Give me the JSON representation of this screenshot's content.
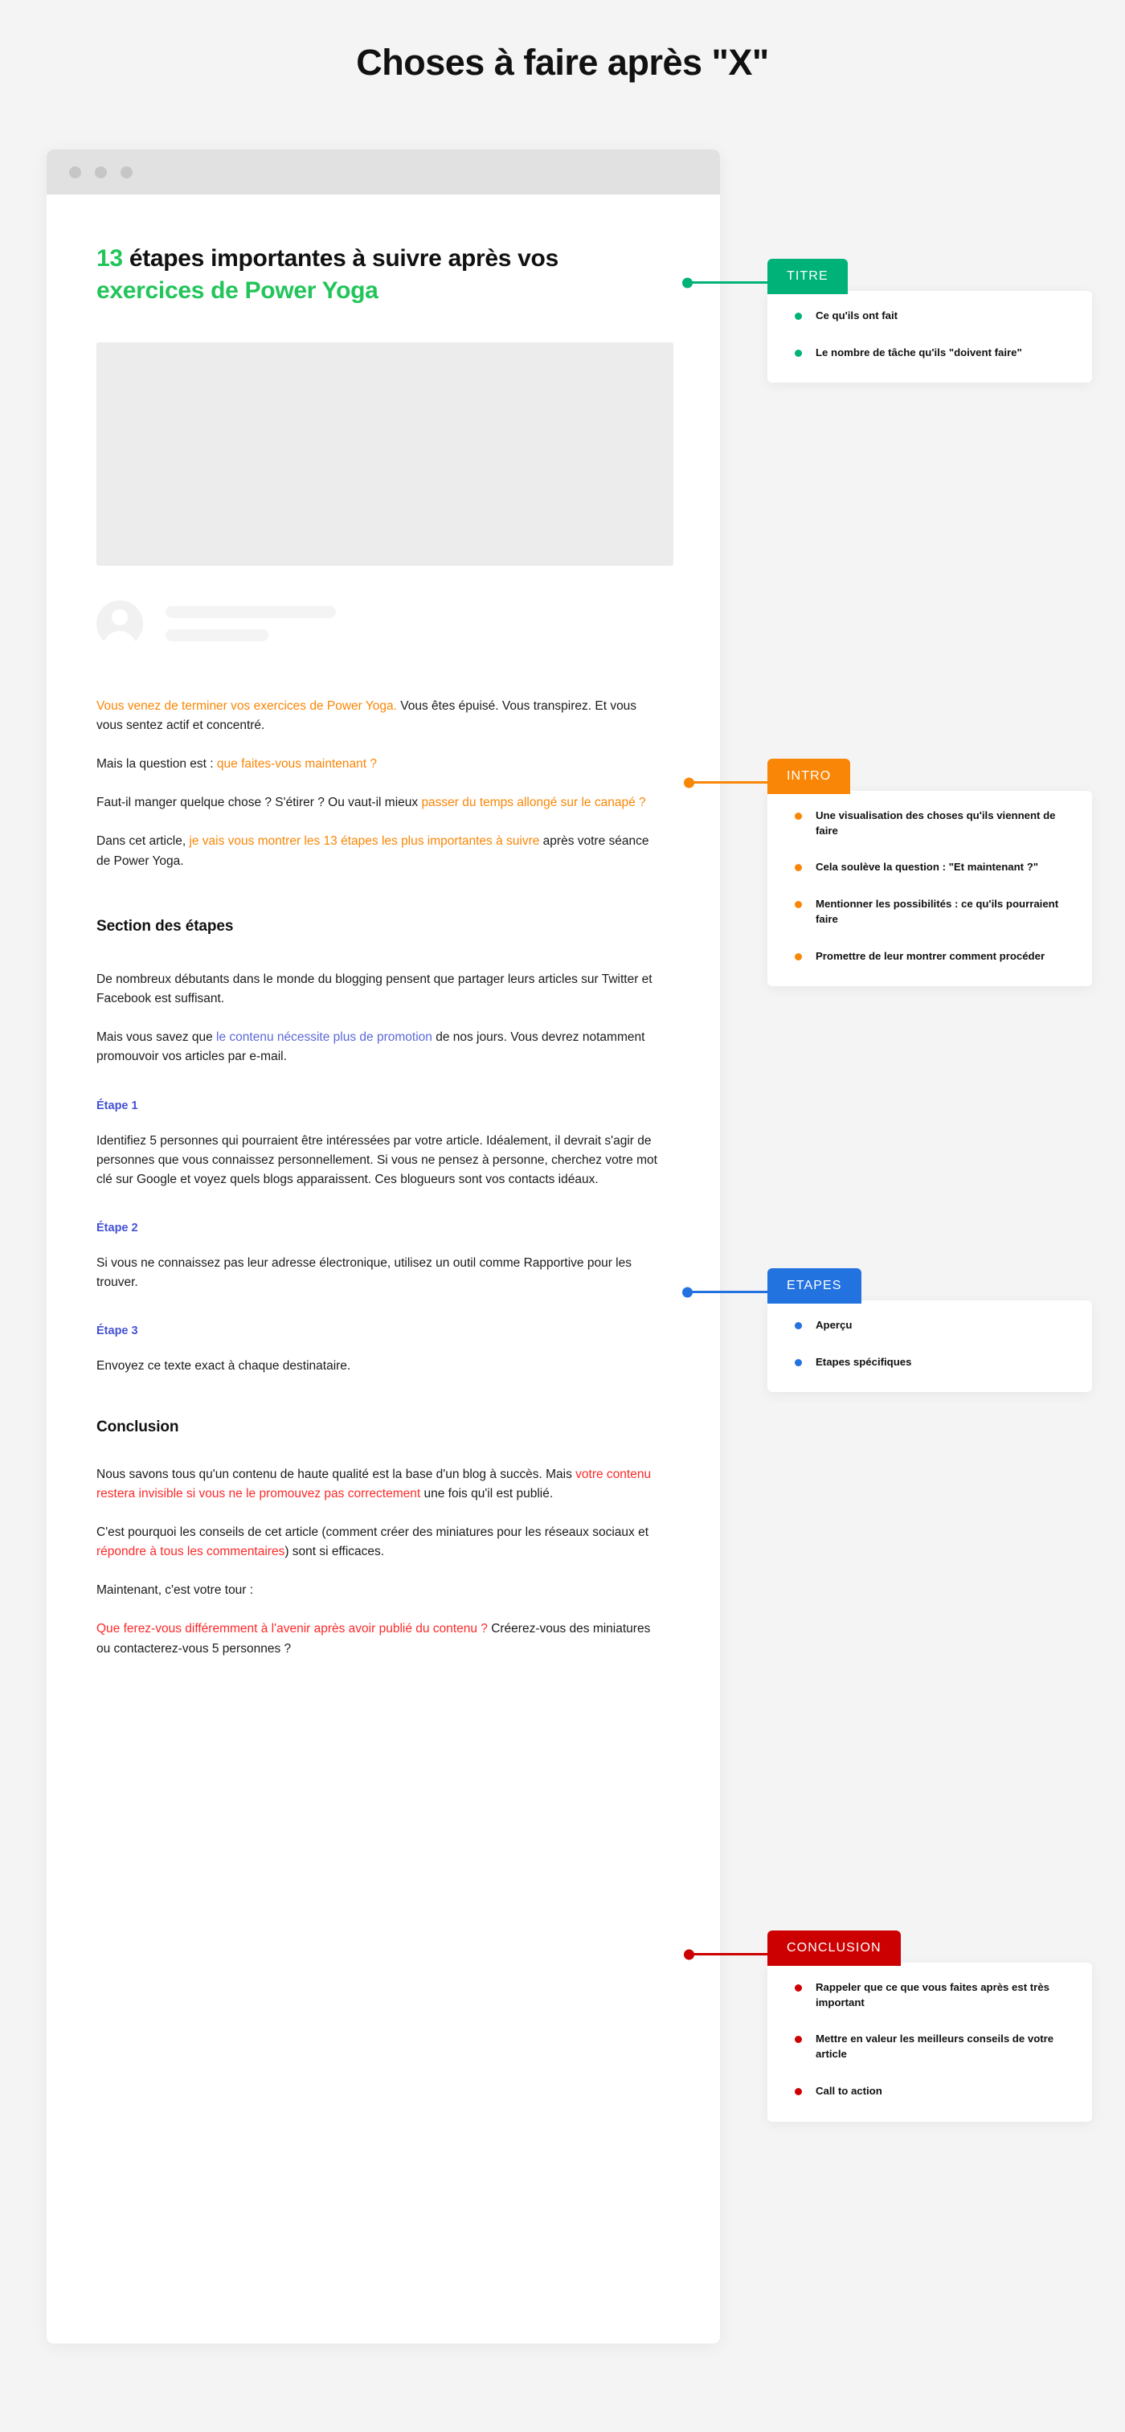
{
  "page": {
    "title": "Choses à faire après \"X\""
  },
  "browser": {
    "chrome_dots": 3
  },
  "article": {
    "headline": {
      "num": "13",
      "mid": " étapes importantes à suivre après vos ",
      "tail": "exercices de Power Yoga"
    },
    "intro": {
      "p1_a": "Vous venez de terminer vos exercices de Power Yoga.",
      "p1_b": " Vous êtes épuisé. Vous transpirez. Et vous vous sentez actif et concentré.",
      "p2_a": "Mais la question est : ",
      "p2_b": "que faites-vous maintenant ?",
      "p3_a": "Faut-il manger quelque chose ? S'étirer ? Ou vaut-il mieux ",
      "p3_b": "passer du temps allongé sur le canapé ?",
      "p4_a": "Dans cet article, ",
      "p4_b": "je vais vous montrer les 13 étapes les plus importantes à suivre",
      "p4_c": " après votre séance de Power Yoga."
    },
    "steps_section": {
      "heading": "Section des étapes",
      "p1": "De nombreux débutants dans le monde du blogging pensent que partager leurs articles sur Twitter et Facebook est suffisant.",
      "p2_a": "Mais vous savez que ",
      "p2_b": "le contenu nécessite plus de promotion",
      "p2_c": " de nos jours. Vous devrez notamment promouvoir vos articles par e-mail.",
      "steps": [
        {
          "label": "Étape 1",
          "text": "Identifiez 5 personnes qui pourraient être intéressées par votre article. Idéalement, il devrait s'agir de personnes que vous connaissez personnellement. Si vous ne pensez à personne, cherchez votre mot clé sur Google et voyez quels blogs apparaissent. Ces blogueurs sont vos contacts idéaux."
        },
        {
          "label": "Étape 2",
          "text": "Si vous ne connaissez pas leur adresse électronique, utilisez un outil comme Rapportive pour les trouver."
        },
        {
          "label": "Étape 3",
          "text": "Envoyez ce texte exact à chaque destinataire."
        }
      ]
    },
    "conclusion_section": {
      "heading": "Conclusion",
      "p1_a": "Nous savons tous qu'un contenu de haute qualité est la base d'un blog à succès. Mais ",
      "p1_b": "votre contenu restera invisible si vous ne le promouvez pas correctement",
      "p1_c": " une fois qu'il est publié.",
      "p2_a": "C'est pourquoi les conseils de cet article (comment créer des miniatures pour les réseaux sociaux et ",
      "p2_b": "répondre à tous les commentaires",
      "p2_c": ") sont si efficaces.",
      "p3": "Maintenant, c'est votre tour :",
      "p4_a": "Que ferez-vous différemment à l'avenir après avoir publié du contenu ?",
      "p4_b": " Créerez-vous des miniatures ou contacterez-vous 5 personnes ?"
    }
  },
  "callouts": [
    {
      "id": "titre",
      "label": "TITRE",
      "color": "#00b277",
      "items": [
        "Ce qu'ils ont fait",
        "Le nombre de tâche qu'ils \"doivent faire\""
      ]
    },
    {
      "id": "intro",
      "label": "INTRO",
      "color": "#f98606",
      "items": [
        "Une visualisation des choses qu'ils viennent de faire",
        "Cela soulève la question : \"Et maintenant ?\"",
        "Mentionner les possibilités : ce qu'ils pourraient faire",
        "Promettre de leur montrer comment procéder"
      ]
    },
    {
      "id": "etapes",
      "label": "ETAPES",
      "color": "#2272e0",
      "items": [
        "Aperçu",
        "Etapes spécifiques"
      ]
    },
    {
      "id": "conclusion",
      "label": "CONCLUSION",
      "color": "#cc0000",
      "items": [
        "Rappeler que ce que vous faites après est très important",
        "Mettre en valeur les meilleurs conseils de votre article",
        "Call to action"
      ]
    }
  ]
}
